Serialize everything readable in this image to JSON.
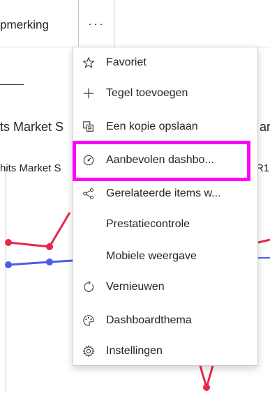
{
  "toolbar": {
    "opmerking_label": "pmerking",
    "more_label": "···"
  },
  "dashboard": {
    "tile1_title": "ts Market S",
    "tile1_right": "ark",
    "tile2_title": "hits Market S",
    "tile2_right": "R1"
  },
  "menu": {
    "items": [
      {
        "label": "Favoriet",
        "icon": "star-icon"
      },
      {
        "label": "Tegel toevoegen",
        "icon": "plus-icon"
      },
      {
        "label": "Een kopie opslaan",
        "icon": "copy-icon"
      },
      {
        "label": "Aanbevolen dashbo...",
        "icon": "insights-icon"
      },
      {
        "label": "Gerelateerde items w...",
        "icon": "share-network-icon"
      },
      {
        "label": "Prestatiecontrole",
        "icon": ""
      },
      {
        "label": "Mobiele weergave",
        "icon": ""
      },
      {
        "label": "Vernieuwen",
        "icon": "refresh-icon"
      },
      {
        "label": "Dashboardthema",
        "icon": "palette-icon"
      },
      {
        "label": "Instellingen",
        "icon": "gear-icon"
      }
    ]
  },
  "colors": {
    "red_series": "#e8274b",
    "blue_series": "#4a5ee8",
    "highlight": "#ff00ff"
  }
}
